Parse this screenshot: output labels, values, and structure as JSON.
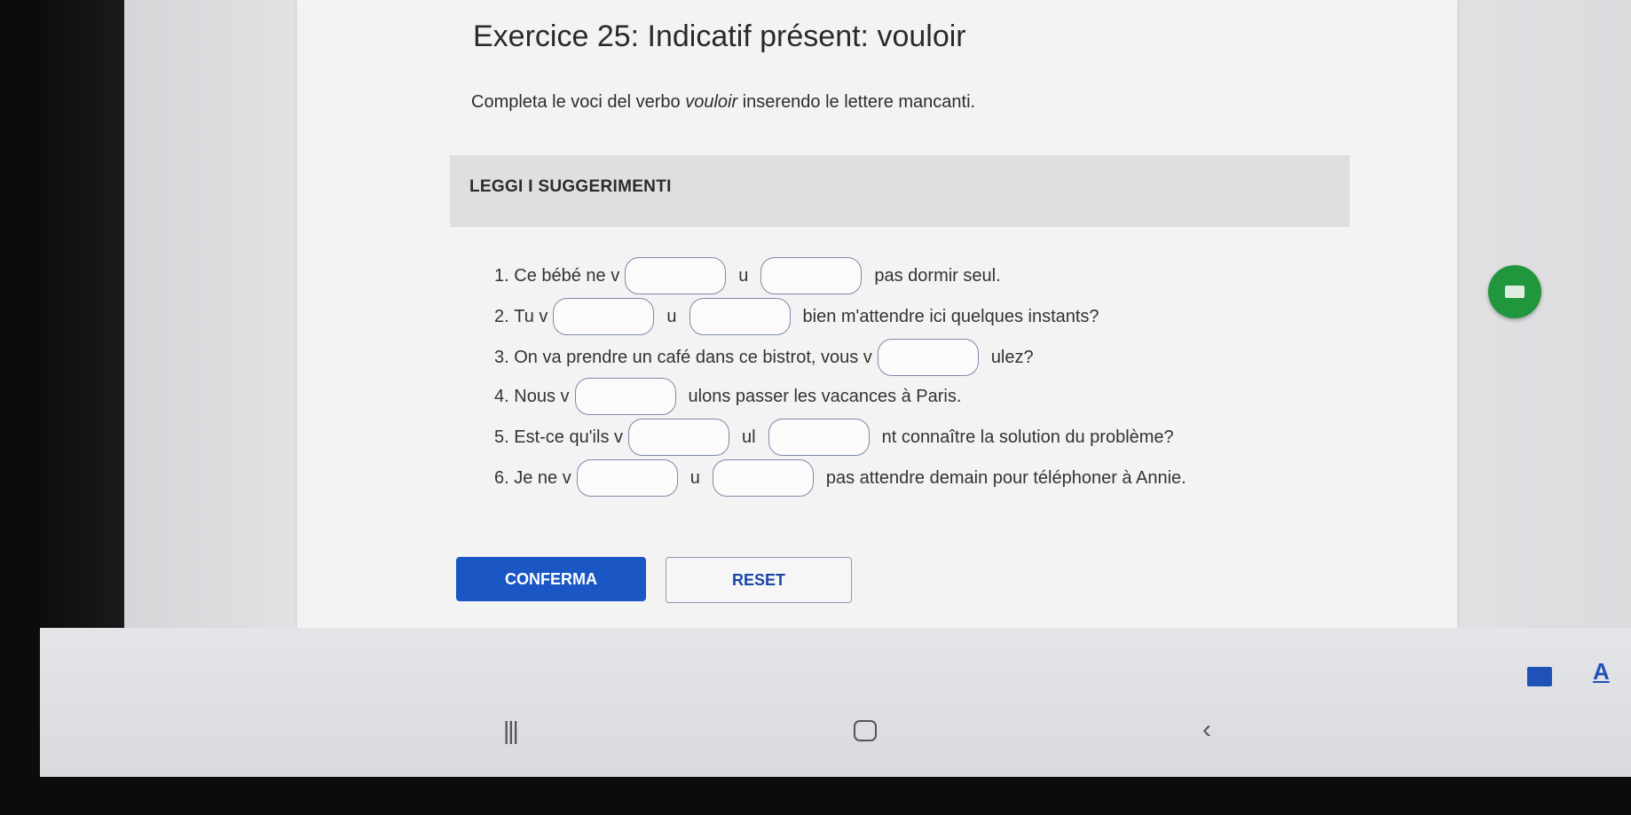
{
  "exercise": {
    "title": "Exercice 25: Indicatif présent: vouloir",
    "instructions_before": "Completa le voci del verbo ",
    "instructions_verb": "vouloir",
    "instructions_after": " inserendo le lettere mancanti.",
    "hints_label": "LEGGI I SUGGERIMENTI"
  },
  "lines": [
    {
      "number": "1.",
      "before": "Ce bébé ne v",
      "mid": "u",
      "after": "pas dormir seul."
    },
    {
      "number": "2.",
      "before": "Tu v",
      "mid": "u",
      "after": "bien m'attendre ici quelques instants?"
    },
    {
      "number": "3.",
      "before": "On va prendre un café dans ce bistrot, vous v",
      "after": "ulez?"
    },
    {
      "number": "4.",
      "before": "Nous v",
      "after": "ulons passer les vacances à Paris."
    },
    {
      "number": "5.",
      "before": "Est-ce qu'ils v",
      "mid": "ul",
      "after": "nt connaître la solution du problème?"
    },
    {
      "number": "6.",
      "before": "Je ne v",
      "mid": "u",
      "after": "pas attendre demain pour téléphoner à Annie."
    }
  ],
  "buttons": {
    "confirm": "CONFERMA",
    "reset": "RESET"
  },
  "icons": {
    "floating_keyboard": "keyboard-icon",
    "bottom_keyboard": "keyboard-icon",
    "text_size": "A"
  },
  "colors": {
    "primary": "#1a57c5",
    "floating_button": "#22963d"
  }
}
